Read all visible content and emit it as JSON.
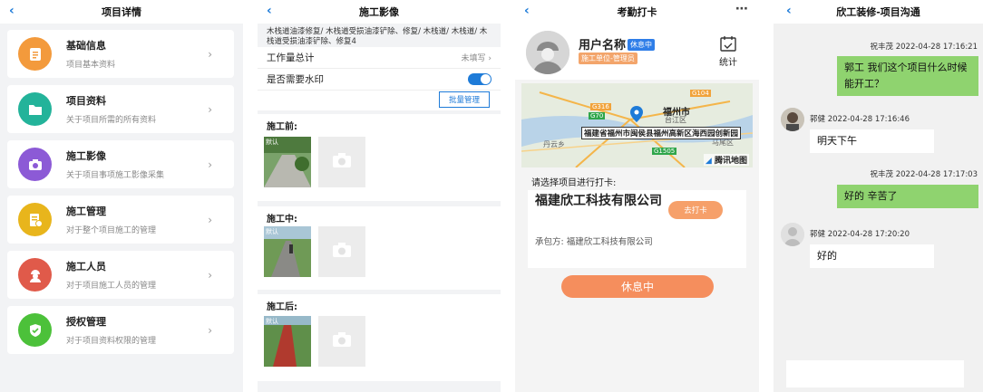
{
  "screen1": {
    "title": "项目详情",
    "menu": [
      {
        "title": "基础信息",
        "subtitle": "项目基本资料",
        "icon": "document-icon",
        "color": "#f39a3c"
      },
      {
        "title": "项目资料",
        "subtitle": "关于项目所需的所有资料",
        "icon": "folder-icon",
        "color": "#23b39a"
      },
      {
        "title": "施工影像",
        "subtitle": "关于项目事项施工影像采集",
        "icon": "camera-icon",
        "color": "#8c5ad6"
      },
      {
        "title": "施工管理",
        "subtitle": "对于整个项目施工的管理",
        "icon": "management-icon",
        "color": "#e8b51c"
      },
      {
        "title": "施工人员",
        "subtitle": "对于项目施工人员的管理",
        "icon": "worker-icon",
        "color": "#e05a4a"
      },
      {
        "title": "授权管理",
        "subtitle": "对于项目资料权限的管理",
        "icon": "shield-check-icon",
        "color": "#4cc13a"
      }
    ]
  },
  "screen2": {
    "title": "施工影像",
    "description": "木栈道油漆修复/ 木栈道受损油漆铲除、修复/ 木栈道/ 木栈道/ 木栈道受损油漆铲除、修复4",
    "workload_label": "工作量总计",
    "workload_value": "未填写",
    "watermark_label": "是否需要水印",
    "batch_button": "批量管理",
    "sections": [
      {
        "label": "施工前:",
        "stamp": "默认"
      },
      {
        "label": "施工中:",
        "stamp": "默认"
      },
      {
        "label": "施工后:",
        "stamp": "默认"
      }
    ]
  },
  "screen3": {
    "title": "考勤打卡",
    "user_name": "用户名称",
    "user_status": "休息中",
    "user_role": "施工单位-管理员",
    "stat_label": "统计",
    "map": {
      "address": "福建省福州市闽侯县福州高新区海西园创新园",
      "city": "福州市",
      "district": "台江区",
      "labels": [
        "G104",
        "G316",
        "G70",
        "G1505",
        "丹云乡",
        "马尾区"
      ],
      "provider": "腾讯地图"
    },
    "choose_label": "请选择项目进行打卡:",
    "company": "福建欣工科技有限公司",
    "punch_button": "去打卡",
    "contractor_label": "承包方: 福建欣工科技有限公司",
    "rest_button": "休息中"
  },
  "screen4": {
    "title": "欣工装修-项目沟通",
    "messages": [
      {
        "side": "right",
        "sender": "祝丰茂",
        "time": "2022-04-28 17:16:21",
        "text": "郭工 我们这个项目什么时候能开工？"
      },
      {
        "side": "left",
        "sender": "郭健",
        "time": "2022-04-28 17:16:46",
        "text": "明天下午"
      },
      {
        "side": "right",
        "sender": "祝丰茂",
        "time": "2022-04-28 17:17:03",
        "text": "好的 辛苦了"
      },
      {
        "side": "left",
        "sender": "郭健",
        "time": "2022-04-28 17:20:20",
        "text": "好的"
      }
    ]
  }
}
